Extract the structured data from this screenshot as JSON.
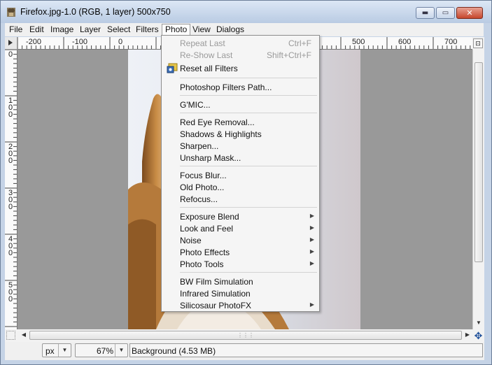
{
  "window": {
    "title": "Firefox.jpg-1.0 (RGB, 1 layer) 500x750",
    "min_glyph": "▬",
    "max_glyph": "▭",
    "close_glyph": "✕"
  },
  "menubar": [
    "File",
    "Edit",
    "Image",
    "Layer",
    "Select",
    "Filters",
    "Photo",
    "View",
    "Dialogs"
  ],
  "rulers": {
    "horizontal": [
      "-200",
      "-100",
      "0",
      "500",
      "600",
      "700"
    ],
    "vertical": [
      "0",
      "1\n0\n0",
      "2\n0\n0",
      "3\n0\n0",
      "4\n0\n0",
      "5\n0\n0"
    ]
  },
  "photo_menu": {
    "items": [
      {
        "label": "Repeat Last",
        "shortcut": "Ctrl+F",
        "disabled": true
      },
      {
        "label": "Re-Show Last",
        "shortcut": "Shift+Ctrl+F",
        "disabled": true
      },
      {
        "label": "Reset all Filters",
        "icon": "reset-filters-icon"
      },
      {
        "label": "Photoshop Filters Path..."
      },
      {
        "label": "G'MIC..."
      },
      {
        "label": "Red Eye Removal..."
      },
      {
        "label": "Shadows & Highlights"
      },
      {
        "label": "Sharpen..."
      },
      {
        "label": "Unsharp Mask..."
      },
      {
        "label": "Focus Blur..."
      },
      {
        "label": "Old Photo..."
      },
      {
        "label": "Refocus..."
      },
      {
        "label": "Exposure Blend",
        "submenu": true
      },
      {
        "label": "Look and Feel",
        "submenu": true
      },
      {
        "label": "Noise",
        "submenu": true
      },
      {
        "label": "Photo Effects",
        "submenu": true
      },
      {
        "label": "Photo Tools",
        "submenu": true
      },
      {
        "label": "BW Film Simulation"
      },
      {
        "label": "Infrared Simulation"
      },
      {
        "label": "Silicosaur PhotoFX",
        "submenu": true
      }
    ],
    "submenu_glyph": "▶"
  },
  "statusbar": {
    "unit": "px",
    "zoom": "67%",
    "layer_info": "Background (4.53 MB)",
    "dropdown_glyph": "▼"
  },
  "colors": {
    "canvas_bg": "#999999",
    "title_gradient_top": "#dce7f5",
    "close_button": "#c6472d"
  }
}
